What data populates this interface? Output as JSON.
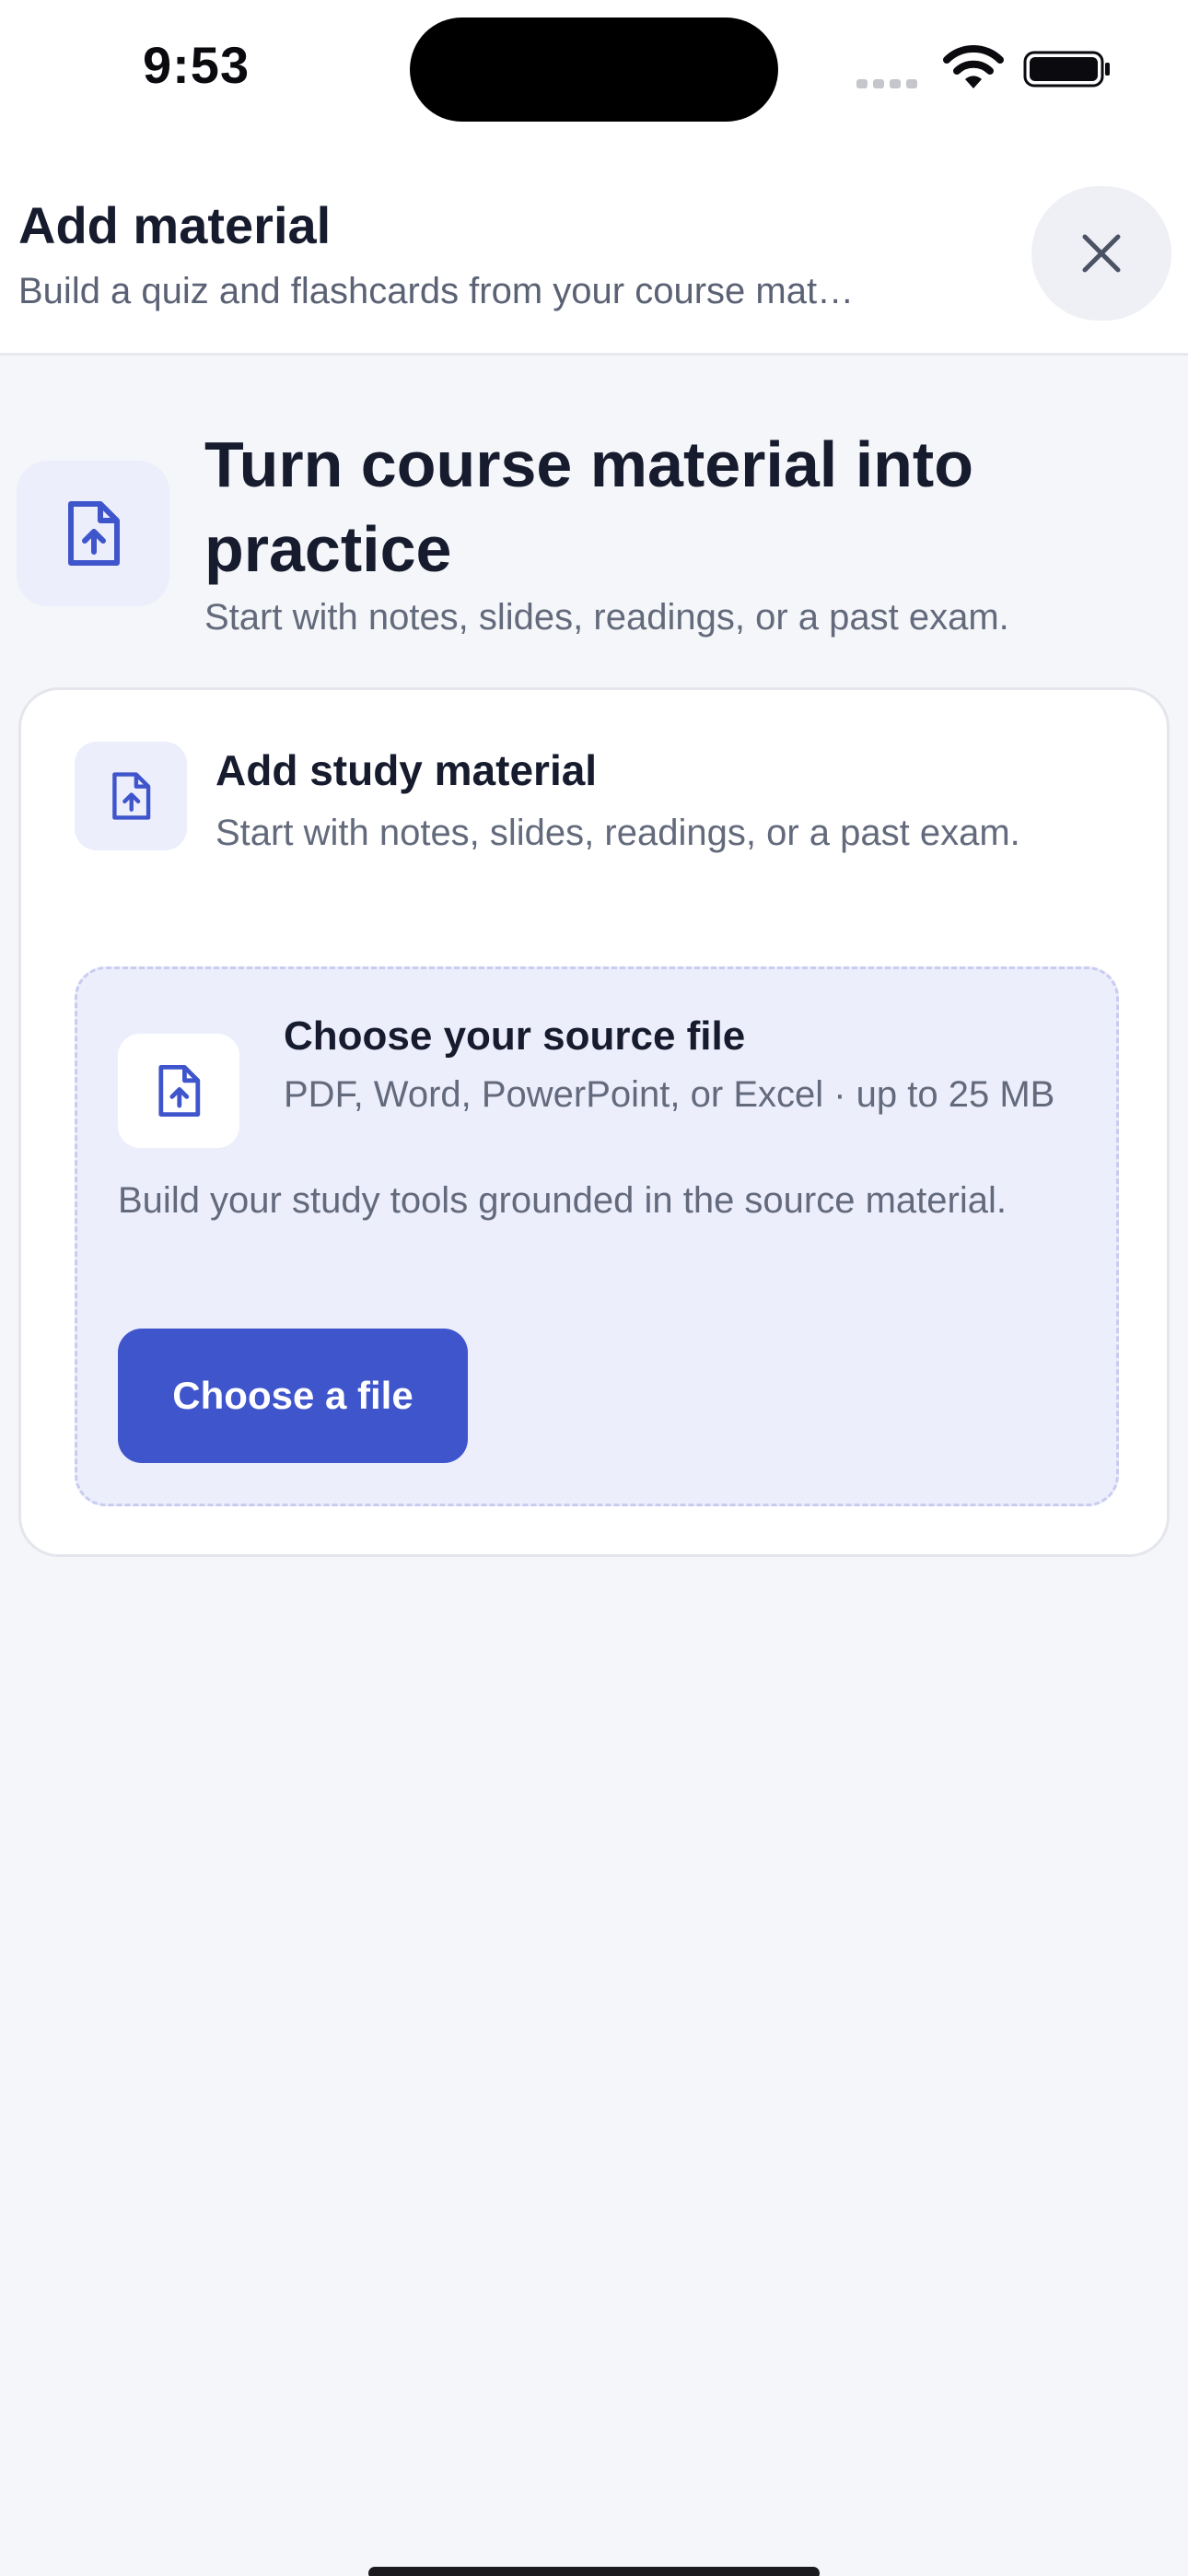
{
  "status_bar": {
    "time": "9:53"
  },
  "header": {
    "title": "Add material",
    "subtitle": "Build a quiz and flashcards from your course mat…",
    "close_icon": "close-icon"
  },
  "hero": {
    "icon": "file-upload-icon",
    "title": "Turn course material into practice",
    "subtitle": "Start with notes, slides, readings, or a past exam."
  },
  "card": {
    "icon": "file-upload-icon",
    "title": "Add study material",
    "description": "Start with notes, slides, readings, or a past exam.",
    "dropzone": {
      "icon": "file-upload-icon",
      "title": "Choose your source file",
      "formats": "PDF, Word, PowerPoint, or Excel · up to 25 MB",
      "description": "Build your study tools grounded in the source material.",
      "button_label": "Choose a file"
    }
  },
  "colors": {
    "accent": "#3f55cc",
    "icon_tint_bg": "#eceefc",
    "page_bg": "#f5f6f9"
  }
}
